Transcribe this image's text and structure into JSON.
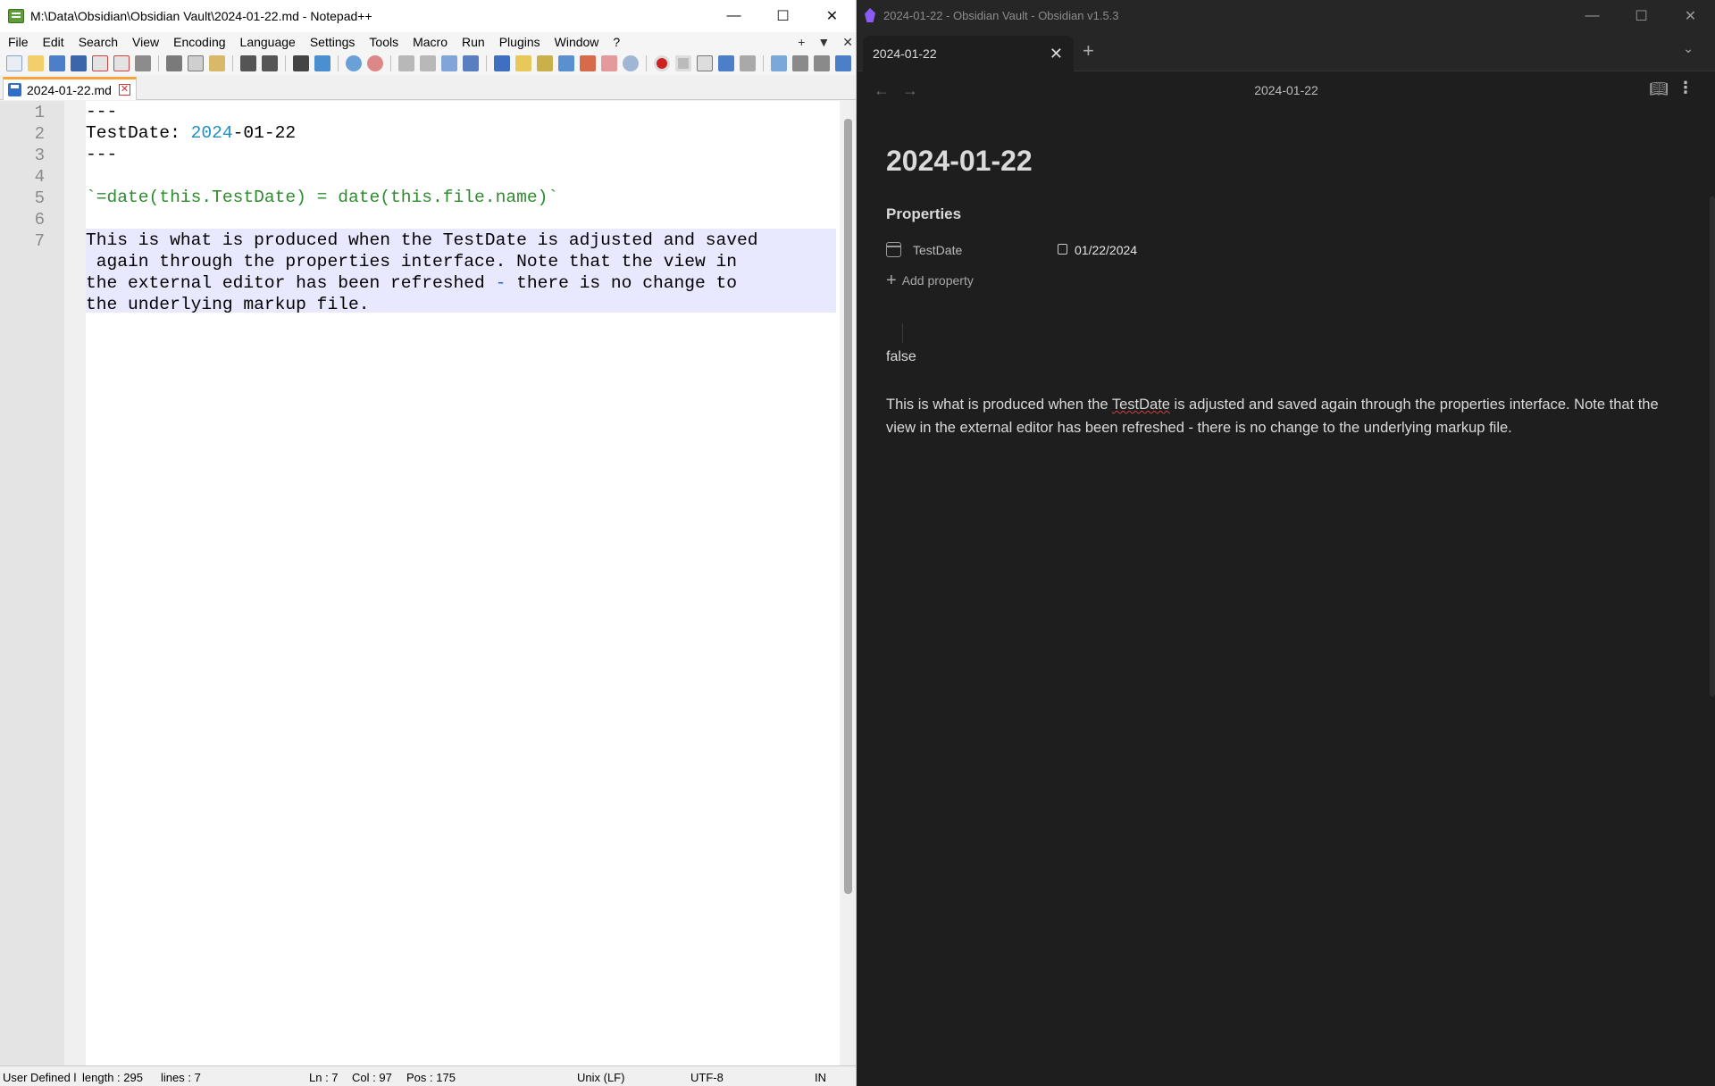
{
  "npp": {
    "title": "M:\\Data\\Obsidian\\Obsidian Vault\\2024-01-22.md - Notepad++",
    "menu": [
      "File",
      "Edit",
      "Search",
      "View",
      "Encoding",
      "Language",
      "Settings",
      "Tools",
      "Macro",
      "Run",
      "Plugins",
      "Window",
      "?"
    ],
    "menu_right": {
      "add": "+",
      "dropdown": "▼",
      "close": "✕"
    },
    "tab_label": "2024-01-22.md",
    "line_numbers": [
      "1",
      "2",
      "3",
      "4",
      "5",
      "6",
      "7"
    ],
    "code": {
      "l1": "---",
      "l2_key": "TestDate: ",
      "l2_year": "2024",
      "l2_rest": "-01-22",
      "l3": "---",
      "l5": "`=date(this.TestDate) = date(this.file.name)`",
      "l7a": "This is what is produced when the TestDate is adjusted and saved",
      "l7b": " again through the properties interface. Note that the view in",
      "l7c_a": "the external editor has been refreshed ",
      "l7c_dash": "-",
      "l7c_b": " there is no change to",
      "l7d": "the underlying markup file."
    },
    "status": {
      "lang": "User Defined l",
      "length": "length : 295",
      "lines": "lines : 7",
      "ln": "Ln : 7",
      "col": "Col : 97",
      "pos": "Pos : 175",
      "eol": "Unix (LF)",
      "encoding": "UTF-8",
      "mode": "IN"
    },
    "colors": {
      "accent_tab": "#f6a43b",
      "number": "#1f8fc4",
      "inline_code": "#2e8b2e"
    }
  },
  "obs": {
    "title": "2024-01-22 - Obsidian Vault - Obsidian v1.5.3",
    "tab_label": "2024-01-22",
    "nav_title": "2024-01-22",
    "note_title": "2024-01-22",
    "properties_heading": "Properties",
    "property": {
      "key": "TestDate",
      "value": "01/22/2024"
    },
    "add_property": "Add property",
    "query_result": "false",
    "body_a": "This is what is produced when the ",
    "body_spell": "TestDate",
    "body_b": " is adjusted and saved again through the properties interface. Note that the view in the external editor has been refreshed - there is no change to the underlying markup file.",
    "colors": {
      "background": "#1e1e1e",
      "accent": "#8a5cf5"
    }
  }
}
